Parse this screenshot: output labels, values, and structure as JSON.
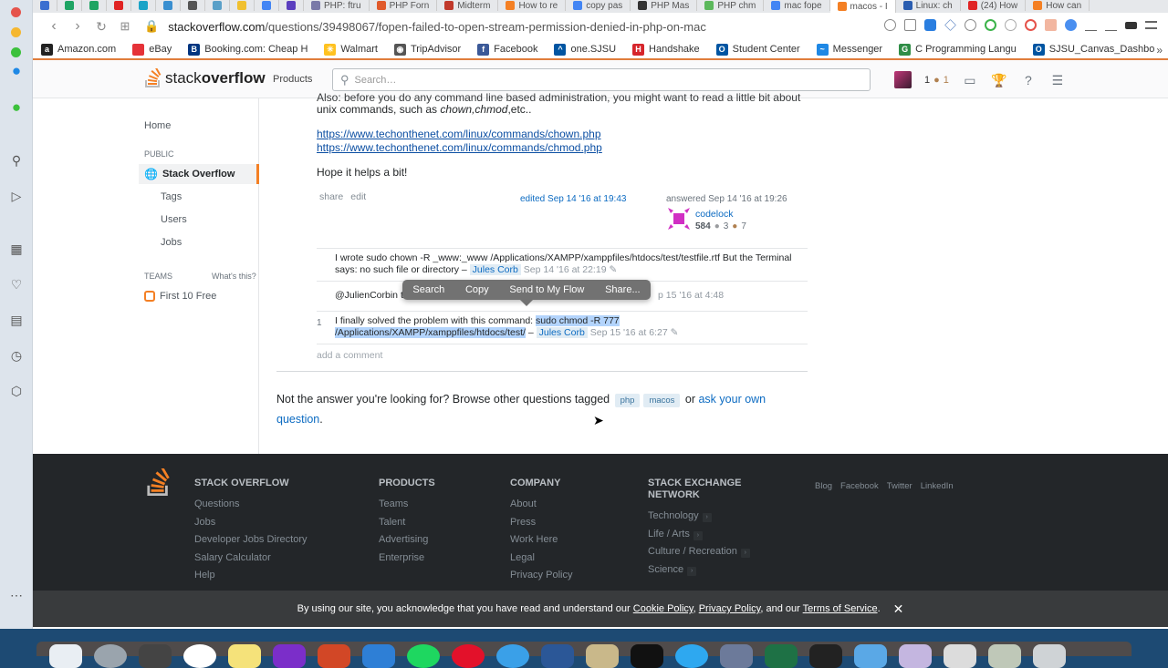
{
  "browser": {
    "tabs": [
      {
        "label": "",
        "color": "#3a6fd0"
      },
      {
        "label": "",
        "color": "#1fa463"
      },
      {
        "label": "",
        "color": "#1fa463"
      },
      {
        "label": "",
        "color": "#e02424"
      },
      {
        "label": "",
        "color": "#1aa3c7"
      },
      {
        "label": "",
        "color": "#3a8fd0"
      },
      {
        "label": "",
        "color": "#555555"
      },
      {
        "label": "",
        "color": "#5aa0c8"
      },
      {
        "label": "",
        "color": "#f0c030"
      },
      {
        "label": "",
        "color": "#4285f4"
      },
      {
        "label": "",
        "color": "#5b3fbf"
      },
      {
        "label": "PHP: ftru",
        "color": "#7a7aa8"
      },
      {
        "label": "PHP Forn",
        "color": "#e05a2b"
      },
      {
        "label": "Midterm",
        "color": "#c0392b"
      },
      {
        "label": "How to re",
        "color": "#f48024"
      },
      {
        "label": "copy pas",
        "color": "#4285f4"
      },
      {
        "label": "PHP Mas",
        "color": "#333333"
      },
      {
        "label": "PHP chm",
        "color": "#5cb85c"
      },
      {
        "label": "mac fope",
        "color": "#4285f4"
      },
      {
        "label": "macos - I",
        "color": "#f48024",
        "active": true
      },
      {
        "label": "Linux: ch",
        "color": "#2a5db0"
      },
      {
        "label": "(24) How",
        "color": "#e02424"
      },
      {
        "label": "How can",
        "color": "#f48024"
      }
    ],
    "url_host": "stackoverflow.com",
    "url_path": "/questions/39498067/fopen-failed-to-open-stream-permission-denied-in-php-on-mac",
    "bookmarks": [
      {
        "label": "Amazon.com",
        "icon": "amazon-icon",
        "glyph": "a",
        "color": "#222222"
      },
      {
        "label": "eBay",
        "icon": "ebay-icon",
        "glyph": "",
        "color": "#e53238"
      },
      {
        "label": "Booking.com: Cheap H",
        "icon": "booking-icon",
        "glyph": "B",
        "color": "#003580"
      },
      {
        "label": "Walmart",
        "icon": "walmart-icon",
        "glyph": "✳",
        "color": "#ffc220"
      },
      {
        "label": "TripAdvisor",
        "icon": "tripadvisor-icon",
        "glyph": "◉",
        "color": "#555555"
      },
      {
        "label": "Facebook",
        "icon": "facebook-icon",
        "glyph": "f",
        "color": "#3b5998"
      },
      {
        "label": "one.SJSU",
        "icon": "sjsu-icon",
        "glyph": "^",
        "color": "#0055a2"
      },
      {
        "label": "Handshake",
        "icon": "handshake-icon",
        "glyph": "H",
        "color": "#d6252b"
      },
      {
        "label": "Student Center",
        "icon": "student-center-icon",
        "glyph": "O",
        "color": "#0055a2"
      },
      {
        "label": "Messenger",
        "icon": "messenger-icon",
        "glyph": "~",
        "color": "#1e88e5"
      },
      {
        "label": "C Programming Langu",
        "icon": "geeksforgeeks-icon",
        "glyph": "G",
        "color": "#2f8d46"
      },
      {
        "label": "SJSU_Canvas_Dashbo",
        "icon": "canvas-icon",
        "glyph": "O",
        "color": "#0055a2"
      }
    ],
    "bookmarks_more": "»"
  },
  "header": {
    "logo_plain": "stack",
    "logo_bold": "overflow",
    "products": "Products",
    "search_placeholder": "Search…",
    "reputation": "1",
    "bronze_badges": "1"
  },
  "leftnav": {
    "home": "Home",
    "public": "PUBLIC",
    "stack_overflow": "Stack Overflow",
    "tags": "Tags",
    "users": "Users",
    "jobs": "Jobs",
    "teams": "TEAMS",
    "whats_this": "What's this?",
    "first_free": "First 10 Free"
  },
  "answer": {
    "cut_line": "Also: before you do any command line based administration, you might want to read a little bit about",
    "line2_prefix": "unix commands, such as ",
    "line2_italic": "chown,chmod",
    "line2_suffix": ",etc..",
    "link1": "https://www.techonthenet.com/linux/commands/chown.php",
    "link2": "https://www.techonthenet.com/linux/commands/chmod.php",
    "closing": "Hope it helps a bit!",
    "share": "share",
    "edit": "edit",
    "edited": "edited Sep 14 '16 at 19:43",
    "answered": "answered Sep 14 '16 at 19:26",
    "user": "codelock",
    "user_rep": "584",
    "silver": "3",
    "bronze": "7"
  },
  "comments": [
    {
      "score": "",
      "text": "I wrote sudo chown -R _www:_www /Applications/XAMPP/xamppfiles/htdocs/test/testfile.rtf But the Terminal says: no such file or directory –",
      "user": "Jules Corb",
      "date": "Sep 14 '16 at 22:19"
    },
    {
      "score": "",
      "text": "@JulienCorbin t",
      "user": "",
      "date": "p 15 '16 at 4:48"
    },
    {
      "score": "1",
      "text_before": "I finally solved the problem with this command: ",
      "text_selected": "sudo chmod -R 777 /Applications/XAMPP/xamppfiles/htdocs/test/",
      "text_after": " –",
      "user": "Jules Corb",
      "date": "Sep 15 '16 at 6:27"
    }
  ],
  "add_comment": "add a comment",
  "context_menu": [
    "Search",
    "Copy",
    "Send to My Flow",
    "Share..."
  ],
  "not_answer": {
    "prefix": "Not the answer you're looking for? Browse other questions tagged ",
    "tags": [
      "php",
      "macos"
    ],
    "or": " or ",
    "ask_link": "ask your own question",
    "suffix": "."
  },
  "footer": {
    "columns": [
      {
        "heading": "STACK OVERFLOW",
        "links": [
          "Questions",
          "Jobs",
          "Developer Jobs Directory",
          "Salary Calculator",
          "Help"
        ]
      },
      {
        "heading": "PRODUCTS",
        "links": [
          "Teams",
          "Talent",
          "Advertising",
          "Enterprise"
        ]
      },
      {
        "heading": "COMPANY",
        "links": [
          "About",
          "Press",
          "Work Here",
          "Legal",
          "Privacy Policy"
        ]
      },
      {
        "heading": "STACK EXCHANGE NETWORK",
        "links": [
          "Technology",
          "Life / Arts",
          "Culture / Recreation",
          "Science"
        ]
      }
    ],
    "social": [
      "Blog",
      "Facebook",
      "Twitter",
      "LinkedIn"
    ]
  },
  "cookie": {
    "prefix": "By using our site, you acknowledge that you have read and understand our ",
    "cookie_policy": "Cookie Policy",
    "sep1": ", ",
    "privacy_policy": "Privacy Policy",
    "sep2": ", and our ",
    "terms": "Terms of Service",
    "suffix": ".",
    "close": "✕"
  },
  "colors": {
    "accent": "#f48024",
    "link": "#0c6bc2",
    "footer_bg": "#232629"
  }
}
